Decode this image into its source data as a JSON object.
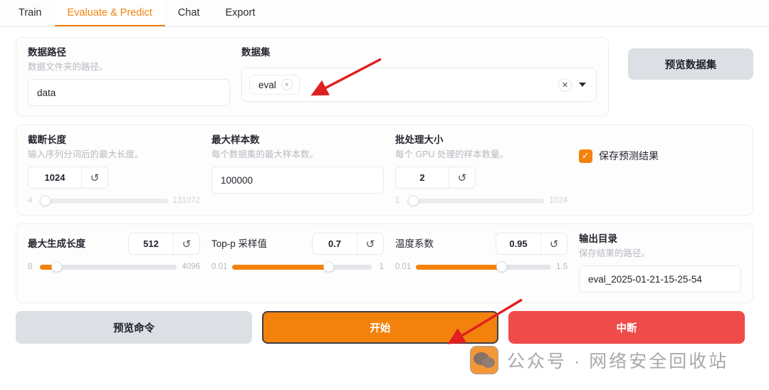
{
  "tabs": [
    {
      "label": "Train",
      "active": false
    },
    {
      "label": "Evaluate & Predict",
      "active": true
    },
    {
      "label": "Chat",
      "active": false
    },
    {
      "label": "Export",
      "active": false
    }
  ],
  "accent_color": "#f2820c",
  "panel1": {
    "data_path": {
      "label": "数据路径",
      "desc": "数据文件夹的路径。",
      "value": "data"
    },
    "dataset": {
      "label": "数据集",
      "tags": [
        "eval"
      ],
      "tag_remove_icon": "×",
      "clear_icon": "✕",
      "caret_icon": "chevron-down-icon"
    },
    "preview_dataset_button": "预览数据集"
  },
  "panel2": {
    "cutoff_len": {
      "label": "截断长度",
      "desc": "输入序列分词后的最大长度。",
      "value": "1024",
      "reset_icon": "↺",
      "min": "4",
      "max": "131072",
      "fill_pct": 0,
      "knob_pct": 4,
      "dim": true
    },
    "max_samples": {
      "label": "最大样本数",
      "desc": "每个数据集的最大样本数。",
      "value": "100000"
    },
    "batch_size": {
      "label": "批处理大小",
      "desc": "每个 GPU 处理的样本数量。",
      "value": "2",
      "reset_icon": "↺",
      "min": "1",
      "max": "1024",
      "fill_pct": 0,
      "knob_pct": 4,
      "dim": true
    },
    "save_predictions": {
      "label": "保存预测结果",
      "checked": true,
      "check_icon": "✓"
    }
  },
  "panel3": {
    "max_new_tokens": {
      "label": "最大生成长度",
      "value": "512",
      "reset_icon": "↺",
      "min": "8",
      "max": "4096",
      "fill_pct": 12,
      "knob_pct": 12
    },
    "top_p": {
      "label": "Top-p 采样值",
      "value": "0.7",
      "reset_icon": "↺",
      "min": "0.01",
      "max": "1",
      "fill_pct": 69,
      "knob_pct": 69
    },
    "temperature": {
      "label": "温度系数",
      "value": "0.95",
      "reset_icon": "↺",
      "min": "0.01",
      "max": "1.5",
      "fill_pct": 63,
      "knob_pct": 63
    },
    "output_dir": {
      "label": "输出目录",
      "desc": "保存结果的路径。",
      "value": "eval_2025-01-21-15-25-54"
    }
  },
  "footer": {
    "preview_command_button": "预览命令",
    "start_button": "开始",
    "abort_button": "中断"
  },
  "watermark": {
    "text": "公众号 · 网络安全回收站",
    "icon": "wechat-icon"
  }
}
